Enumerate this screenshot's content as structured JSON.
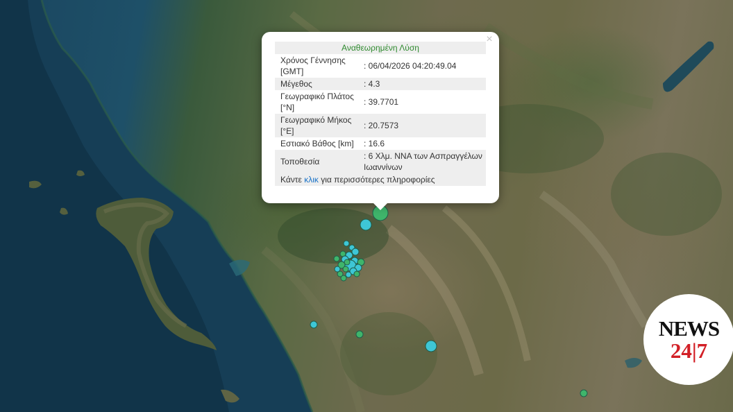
{
  "popup": {
    "title": "Αναθεωρημένη Λύση",
    "close_symbol": "×",
    "rows": [
      {
        "label_line1": "Χρόνος Γέννησης",
        "label_line2": "[GMT]",
        "value": ": 06/04/2026 04:20:49.04"
      },
      {
        "label_line1": "Μέγεθος",
        "label_line2": "",
        "value": ": 4.3"
      },
      {
        "label_line1": "Γεωγραφικό Πλάτος",
        "label_line2": "[°N]",
        "value": ": 39.7701"
      },
      {
        "label_line1": "Γεωγραφικό Μήκος",
        "label_line2": "[°E]",
        "value": ": 20.7573"
      },
      {
        "label_line1": "Εστιακό Βάθος [km]",
        "label_line2": "",
        "value": ": 16.6"
      },
      {
        "label_line1": "Τοποθεσία",
        "label_line2": "",
        "value": ": 6 Χλμ. ΝΝΑ των Ασπραγγέλων Ιωαννίνων"
      }
    ],
    "more_prefix": "Κάντε ",
    "more_link": "κλικ",
    "more_suffix": " για περισσότερες πληροφορίες"
  },
  "logo": {
    "word1": "NEWS",
    "word2": "24|7",
    "color_dark": "#111111",
    "color_red": "#d21f26"
  },
  "marker_colors": {
    "green": "#3fb56b",
    "cyan": "#3ec6d6",
    "outline": "#1f5d4a"
  }
}
